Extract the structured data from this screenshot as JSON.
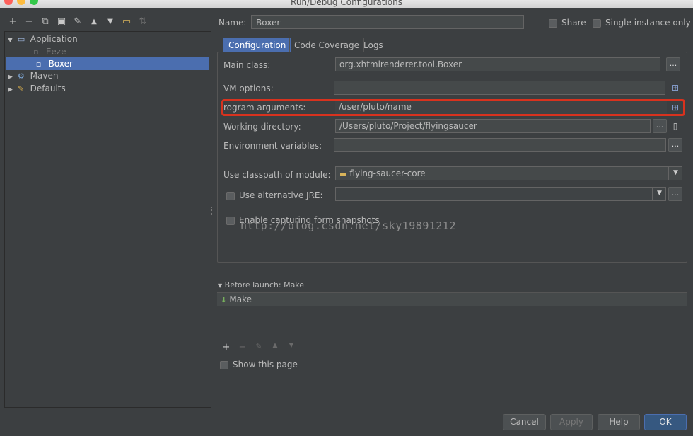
{
  "window": {
    "title": "Run/Debug Configurations"
  },
  "left_toolbar": {
    "icons": [
      "plus-icon",
      "minus-icon",
      "copy-icon",
      "save-icon",
      "wrench-icon",
      "move-up-icon",
      "move-down-icon",
      "folder-icon",
      "sort-icon"
    ],
    "glyphs": [
      "+",
      "−",
      "⧉",
      "▣",
      "✎",
      "▲",
      "▼",
      "▭",
      "⇅"
    ]
  },
  "tree": {
    "nodes": [
      {
        "label": "Application",
        "expanded": true
      },
      {
        "label": "Eeze"
      },
      {
        "label": "Boxer",
        "selected": true
      },
      {
        "label": "Maven"
      },
      {
        "label": "Defaults"
      }
    ]
  },
  "header": {
    "name_label": "Name:",
    "name_value": "Boxer",
    "share_label": "Share",
    "single_instance_label": "Single instance only"
  },
  "tabs": [
    {
      "label": "Configuration",
      "active": true
    },
    {
      "label": "Code Coverage"
    },
    {
      "label": "Logs"
    }
  ],
  "fields": {
    "main_class": {
      "label": "Main class:",
      "value": "org.xhtmlrenderer.tool.Boxer"
    },
    "vm_options": {
      "label": "VM options:",
      "value": ""
    },
    "program_arguments": {
      "label": "rogram arguments:",
      "value": "/user/pluto/name"
    },
    "working_directory": {
      "label": "Working directory:",
      "value": "/Users/pluto/Project/flyingsaucer"
    },
    "environment_variables": {
      "label": "Environment variables:",
      "value": ""
    },
    "classpath_module": {
      "label": "Use classpath of module:",
      "value": "flying-saucer-core"
    },
    "alternative_jre": {
      "label": "Use alternative JRE:",
      "value": ""
    },
    "capture_snapshots": {
      "label": "Enable capturing form snapshots"
    }
  },
  "watermark": "http://blog.csdn.net/sky19891212",
  "before_launch": {
    "header": "Before launch: Make",
    "items": [
      "Make"
    ],
    "toolbar_glyphs": [
      "+",
      "−",
      "✎",
      "▲",
      "▼"
    ],
    "show_page_label": "Show this page"
  },
  "buttons": {
    "ellipsis": "...",
    "cancel": "Cancel",
    "apply": "Apply",
    "help": "Help",
    "ok": "OK"
  },
  "colors": {
    "accent": "#4b6eaf",
    "highlight_border": "#d8321e",
    "background": "#3c3f41"
  }
}
